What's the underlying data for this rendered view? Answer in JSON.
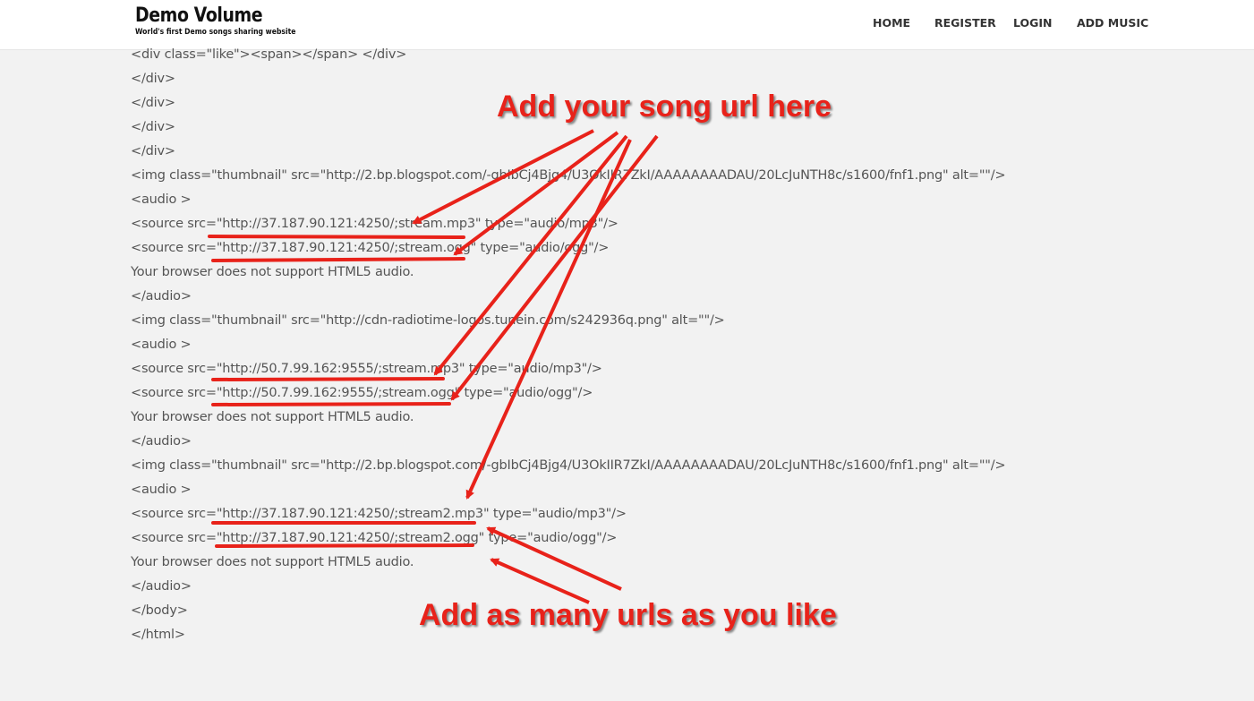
{
  "header": {
    "logo_title": "Demo Volume",
    "logo_tagline": "World's first Demo songs sharing website",
    "nav": [
      "HOME",
      "REGISTER",
      "LOGIN",
      "ADD MUSIC"
    ]
  },
  "code_lines": [
    "<div class=\"like\"><span></span> </div>",
    "</div>",
    "</div>",
    "</div>",
    "</div>",
    "<img class=\"thumbnail\" src=\"http://2.bp.blogspot.com/-gbIbCj4Bjg4/U3OkIIR7ZkI/AAAAAAAADAU/20LcJuNTH8c/s1600/fnf1.png\" alt=\"\"/>",
    "<audio >",
    "<source src=\"http://37.187.90.121:4250/;stream.mp3\" type=\"audio/mp3\"/>",
    "<source src=\"http://37.187.90.121:4250/;stream.ogg\" type=\"audio/ogg\"/>",
    "Your browser does not support HTML5 audio.",
    "</audio>",
    "<img class=\"thumbnail\" src=\"http://cdn-radiotime-logos.tunein.com/s242936q.png\" alt=\"\"/>",
    "<audio >",
    "<source src=\"http://50.7.99.162:9555/;stream.mp3\" type=\"audio/mp3\"/>",
    "<source src=\"http://50.7.99.162:9555/;stream.ogg\" type=\"audio/ogg\"/>",
    "Your browser does not support HTML5 audio.",
    "</audio>",
    "<img class=\"thumbnail\" src=\"http://2.bp.blogspot.com/-gbIbCj4Bjg4/U3OkIIR7ZkI/AAAAAAAADAU/20LcJuNTH8c/s1600/fnf1.png\" alt=\"\"/>",
    "<audio >",
    "<source src=\"http://37.187.90.121:4250/;stream2.mp3\" type=\"audio/mp3\"/>",
    "<source src=\"http://37.187.90.121:4250/;stream2.ogg\" type=\"audio/ogg\"/>",
    "Your browser does not support HTML5 audio.",
    "</audio>",
    "</body>",
    "</html>"
  ],
  "annotations": {
    "top": "Add your song url here",
    "bottom": "Add as many urls as you like"
  },
  "colors": {
    "annotation": "#e8221a",
    "background": "#f2f2f2",
    "header": "#ffffff"
  }
}
